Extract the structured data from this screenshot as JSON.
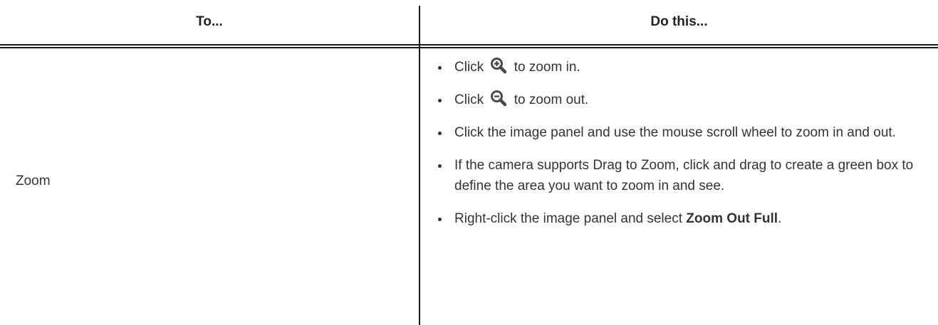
{
  "table": {
    "header": {
      "col1": "To...",
      "col2": "Do this..."
    },
    "row": {
      "action": "Zoom",
      "steps": [
        {
          "prefix": "Click",
          "icon": "zoom-in-icon",
          "suffix": "to zoom in."
        },
        {
          "prefix": "Click",
          "icon": "zoom-out-icon",
          "suffix": "to zoom out."
        },
        {
          "text": "Click the image panel and use the mouse scroll wheel to zoom in and out."
        },
        {
          "text": "If the camera supports Drag to Zoom, click and drag to create a green box to define the area you want to zoom in and see."
        },
        {
          "prefix": "Right-click the image panel and select",
          "bold": "Zoom Out Full",
          "suffix": "."
        }
      ]
    }
  },
  "colors": {
    "text": "#333333",
    "rule": "#1a1a1a",
    "icon": "#4a4a4a"
  }
}
